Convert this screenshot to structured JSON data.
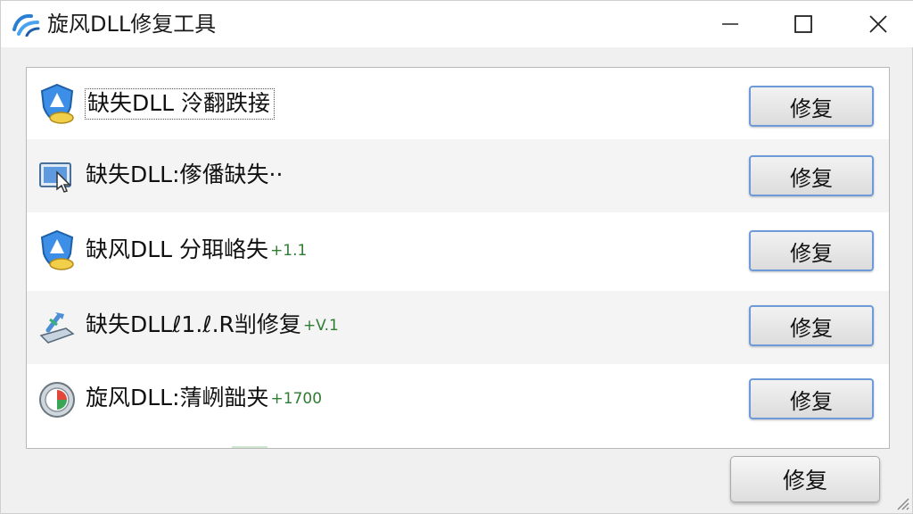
{
  "window": {
    "title": "旋风DLL修复工具",
    "app_icon": "swirl-logo-icon",
    "controls": {
      "minimize": "minimize-icon",
      "maximize": "maximize-icon",
      "close": "close-icon"
    }
  },
  "list": {
    "items": [
      {
        "label": "缺失DLL 泠翻跌接",
        "tag": "",
        "icon": "shield-icon",
        "button": "修复"
      },
      {
        "label": "缺失DLL:偧僠缺失··",
        "tag": "",
        "icon": "monitor-cursor-icon",
        "button": "修复"
      },
      {
        "label": "缺风DLL 分聑峈失",
        "tag": "+1.1",
        "icon": "shield-icon",
        "button": "修复"
      },
      {
        "label": "缺失DLLℓ1.ℓ.R㓥修复",
        "tag": "+V.1",
        "icon": "wrench-icon",
        "button": "修复"
      },
      {
        "label": "旋风DLL:蔳峢韷夹",
        "tag": "+1700",
        "icon": "clock-icon",
        "button": "修复"
      }
    ]
  },
  "footer": {
    "button": "修复"
  },
  "colors": {
    "accent_border": "#6d9ad8",
    "tag_green": "#2e7d32",
    "logo_blue": "#2a7fd4"
  }
}
